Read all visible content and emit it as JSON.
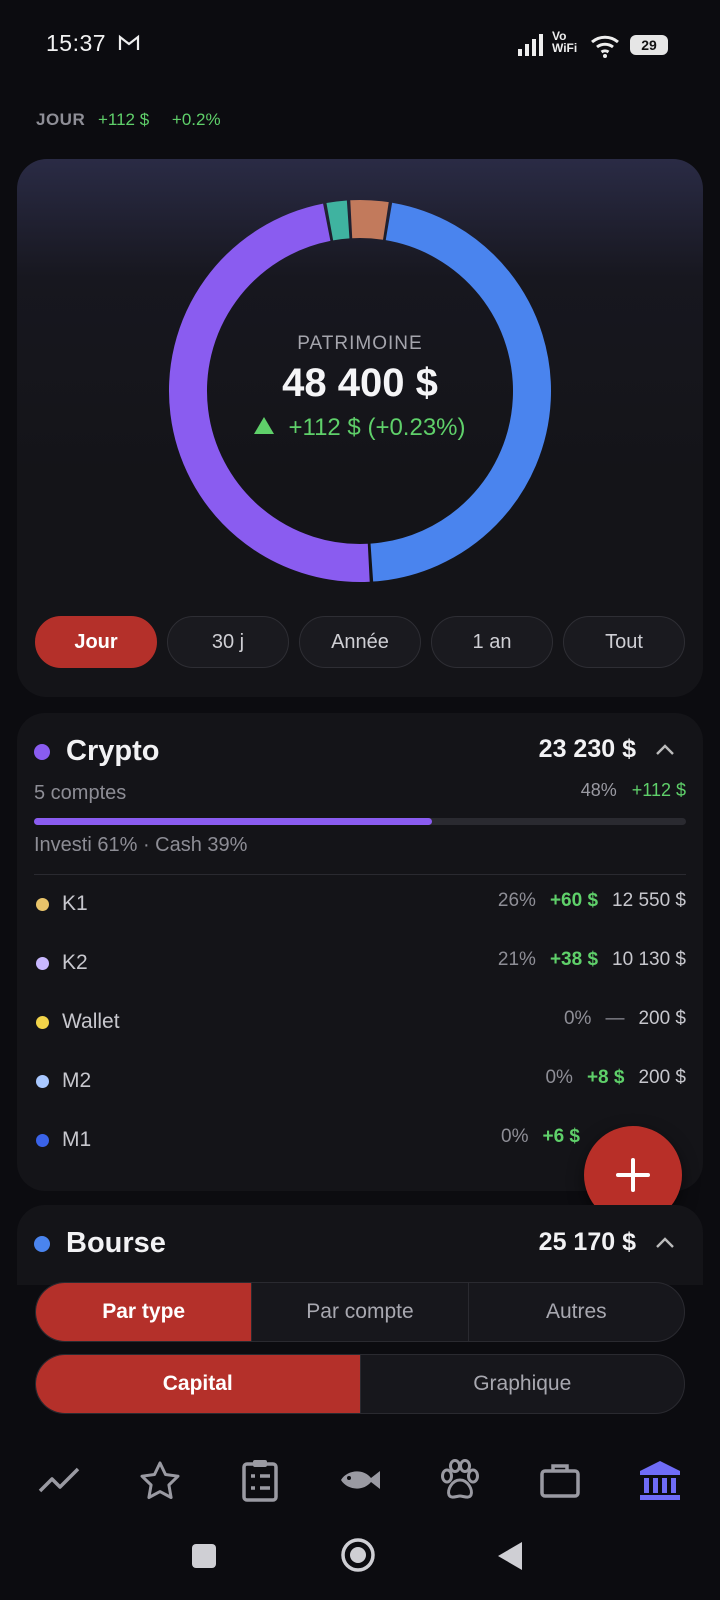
{
  "status_bar": {
    "time": "15:37",
    "vowifi_top": "Vo",
    "vowifi_bottom": "WiFi",
    "battery": "29"
  },
  "day_summary": {
    "label": "JOUR",
    "change": "+112 $",
    "percent": "+0.2%"
  },
  "overview": {
    "label": "PATRIMOINE",
    "total": "48 400 $",
    "change": "+112 $ (+0.23%)",
    "donut": [
      {
        "category": "Crypto",
        "share": 0.48,
        "color": "#8a5cf0"
      },
      {
        "category": "Bourse",
        "share": 0.465,
        "color": "#4a84ee"
      },
      {
        "category": "other-1",
        "share": 0.035,
        "color": "#c27a5c"
      },
      {
        "category": "other-2",
        "share": 0.02,
        "color": "#3fb3a0"
      }
    ]
  },
  "periods": [
    {
      "label": "Jour",
      "active": true
    },
    {
      "label": "30 j",
      "active": false
    },
    {
      "label": "Année",
      "active": false
    },
    {
      "label": "1 an",
      "active": false
    },
    {
      "label": "Tout",
      "active": false
    }
  ],
  "crypto": {
    "title": "Crypto",
    "total": "23 230 $",
    "accounts": "5 comptes",
    "percent": "48%",
    "change": "+112 $",
    "invest_fraction": 0.61,
    "split": "Investi 61% · Cash 39%",
    "color": "#8a5cf0",
    "rows": [
      {
        "name": "K1",
        "pct": "26%",
        "change": "+60 $",
        "amount": "12 550 $",
        "color": "#e9c46a"
      },
      {
        "name": "K2",
        "pct": "21%",
        "change": "+38 $",
        "amount": "10 130 $",
        "color": "#c9b8ff"
      },
      {
        "name": "Wallet",
        "pct": "0%",
        "change": "—",
        "amount": "200 $",
        "color": "#f2d44a"
      },
      {
        "name": "M2",
        "pct": "0%",
        "change": "+8 $",
        "amount": "200 $",
        "color": "#a9c8ff"
      },
      {
        "name": "M1",
        "pct": "0%",
        "change": "+6 $",
        "amount": "",
        "color": "#3a63e8"
      }
    ]
  },
  "bourse": {
    "title": "Bourse",
    "total": "25 170 $",
    "color": "#4a84ee"
  },
  "group_by": [
    {
      "label": "Par type",
      "active": true
    },
    {
      "label": "Par compte",
      "active": false
    },
    {
      "label": "Autres",
      "active": false
    }
  ],
  "view_mode": [
    {
      "label": "Capital",
      "active": true
    },
    {
      "label": "Graphique",
      "active": false
    }
  ],
  "nav": [
    "trend-icon",
    "star-icon",
    "clipboard-icon",
    "fish-icon",
    "paw-icon",
    "briefcase-icon",
    "bank-icon"
  ]
}
